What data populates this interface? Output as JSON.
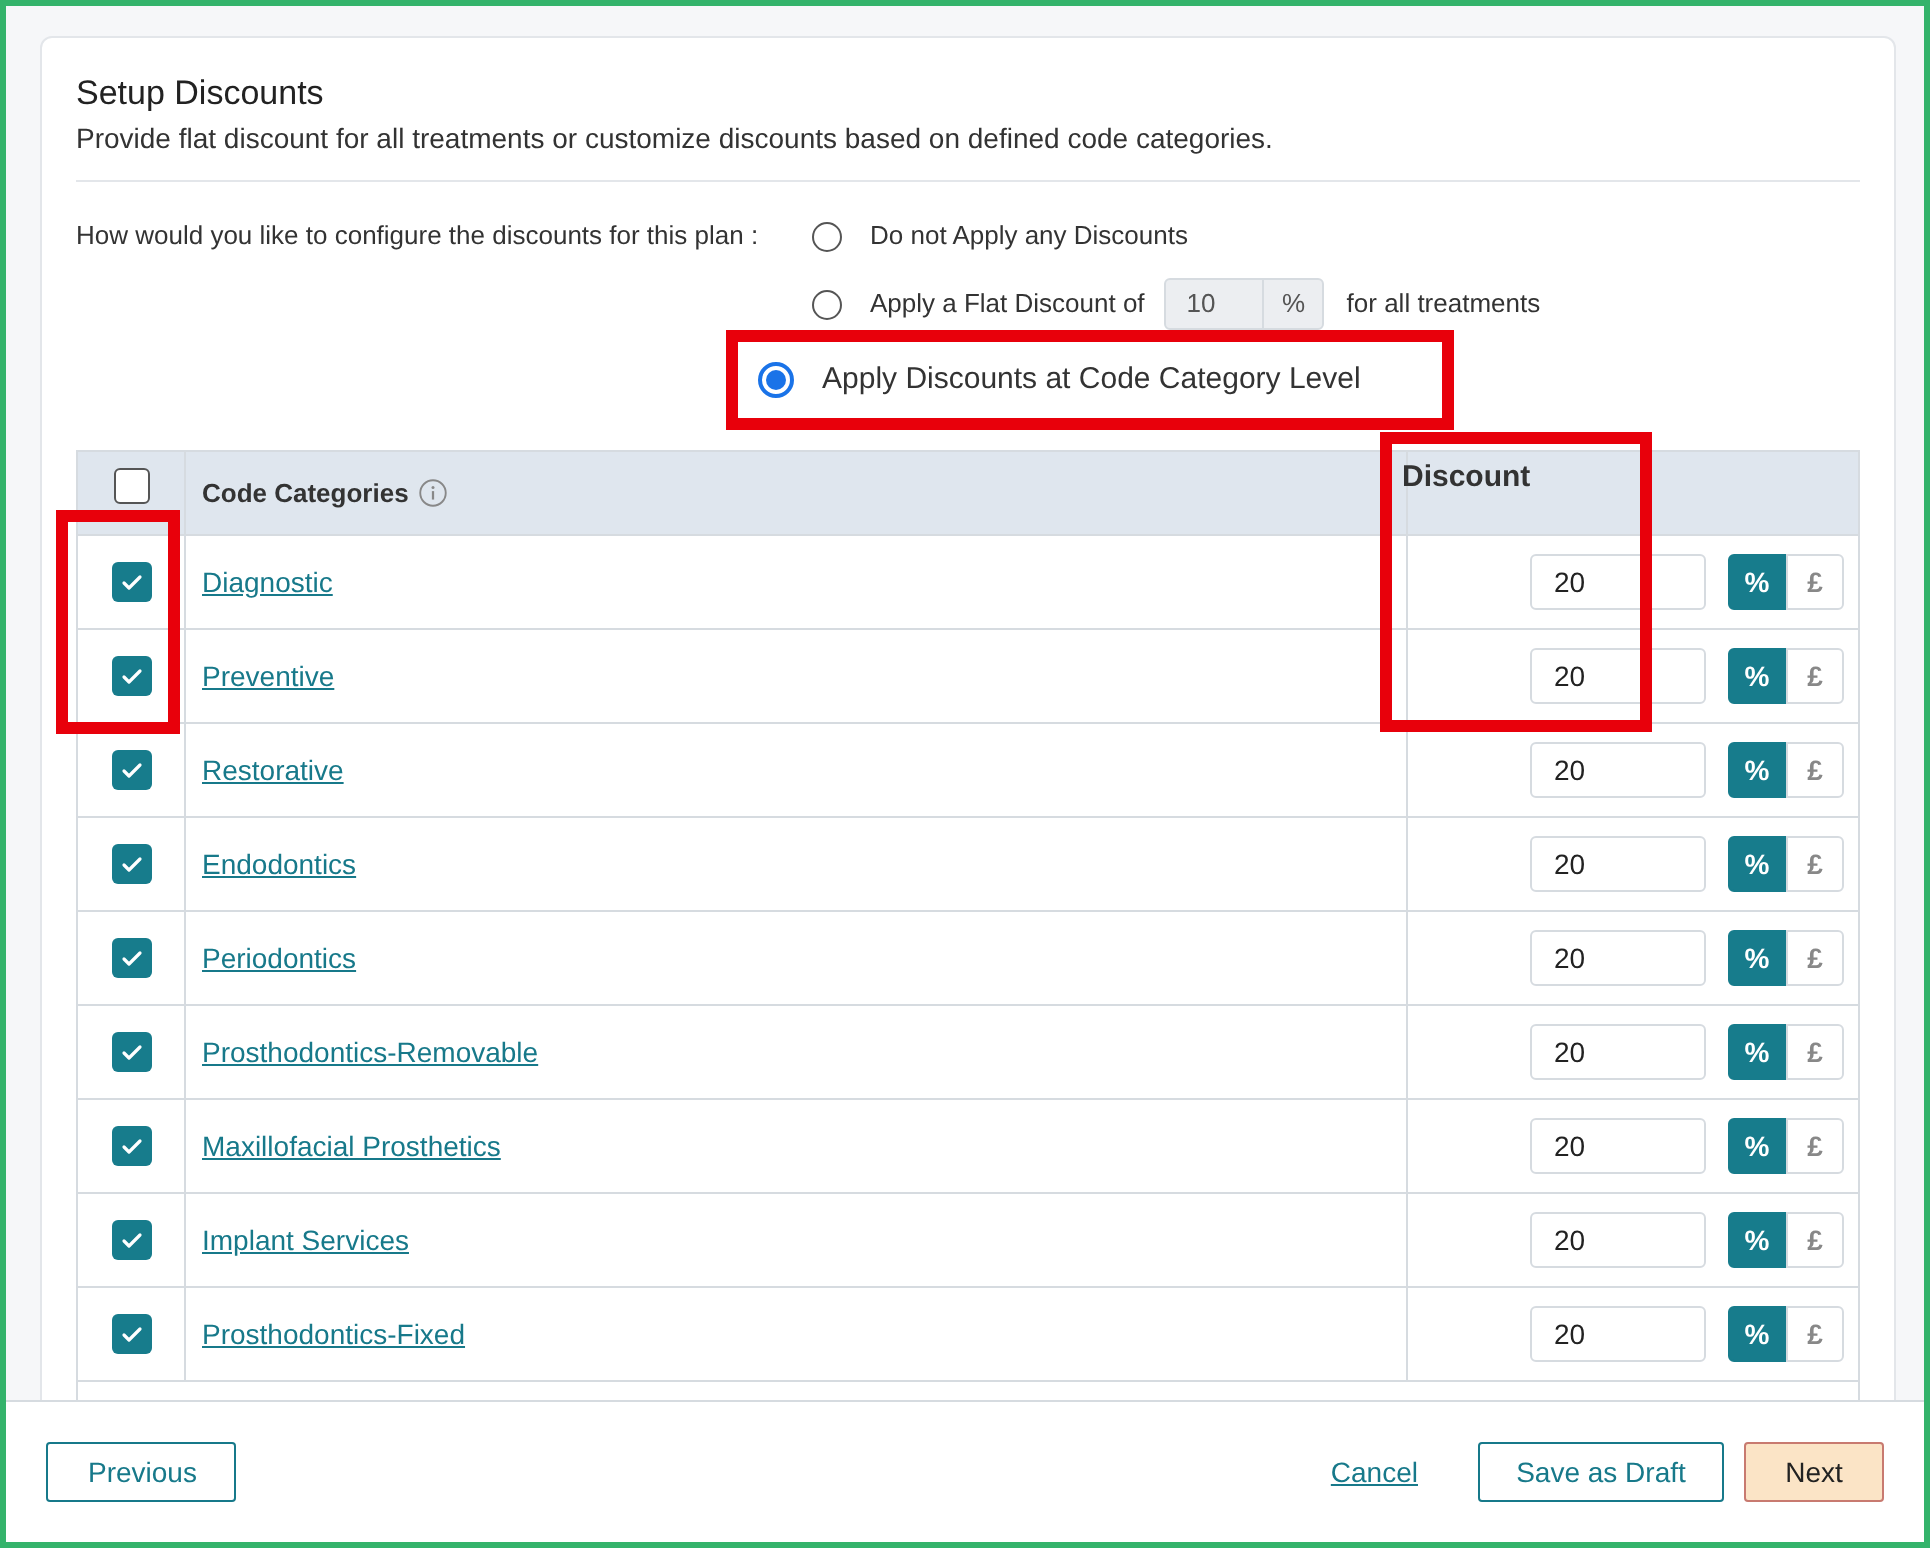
{
  "title": "Setup Discounts",
  "subtitle": "Provide flat discount for all treatments or customize discounts based on defined code categories.",
  "question": "How would you like to configure the discounts for this plan :",
  "options": [
    {
      "kind": "plain",
      "label": "Do not Apply any Discounts",
      "selected": false
    },
    {
      "kind": "flat",
      "label": "Apply a Flat Discount of",
      "value": "10",
      "unit": "%",
      "suffix": "for all treatments",
      "selected": false
    },
    {
      "kind": "plain",
      "label": "Apply Discounts at Code Category Level",
      "selected": true
    }
  ],
  "table": {
    "select_all_checked": false,
    "columns": [
      "Code Categories",
      "Discount"
    ],
    "rows": [
      {
        "category": "Diagnostic",
        "checked": true,
        "discount": "20",
        "units": [
          {
            "label": "%",
            "selected": true
          },
          {
            "label": "£",
            "selected": false
          }
        ]
      },
      {
        "category": "Preventive",
        "checked": true,
        "discount": "20",
        "units": [
          {
            "label": "%",
            "selected": true
          },
          {
            "label": "£",
            "selected": false
          }
        ]
      },
      {
        "category": "Restorative",
        "checked": true,
        "discount": "20",
        "units": [
          {
            "label": "%",
            "selected": true
          },
          {
            "label": "£",
            "selected": false
          }
        ]
      },
      {
        "category": "Endodontics",
        "checked": true,
        "discount": "20",
        "units": [
          {
            "label": "%",
            "selected": true
          },
          {
            "label": "£",
            "selected": false
          }
        ]
      },
      {
        "category": "Periodontics",
        "checked": true,
        "discount": "20",
        "units": [
          {
            "label": "%",
            "selected": true
          },
          {
            "label": "£",
            "selected": false
          }
        ]
      },
      {
        "category": "Prosthodontics-Removable",
        "checked": true,
        "discount": "20",
        "units": [
          {
            "label": "%",
            "selected": true
          },
          {
            "label": "£",
            "selected": false
          }
        ]
      },
      {
        "category": "Maxillofacial Prosthetics",
        "checked": true,
        "discount": "20",
        "units": [
          {
            "label": "%",
            "selected": true
          },
          {
            "label": "£",
            "selected": false
          }
        ]
      },
      {
        "category": "Implant Services",
        "checked": true,
        "discount": "20",
        "units": [
          {
            "label": "%",
            "selected": true
          },
          {
            "label": "£",
            "selected": false
          }
        ]
      },
      {
        "category": "Prosthodontics-Fixed",
        "checked": true,
        "discount": "20",
        "units": [
          {
            "label": "%",
            "selected": true
          },
          {
            "label": "£",
            "selected": false
          }
        ]
      }
    ]
  },
  "footer": {
    "previous": "Previous",
    "cancel": "Cancel",
    "save_draft": "Save as Draft",
    "next": "Next"
  }
}
